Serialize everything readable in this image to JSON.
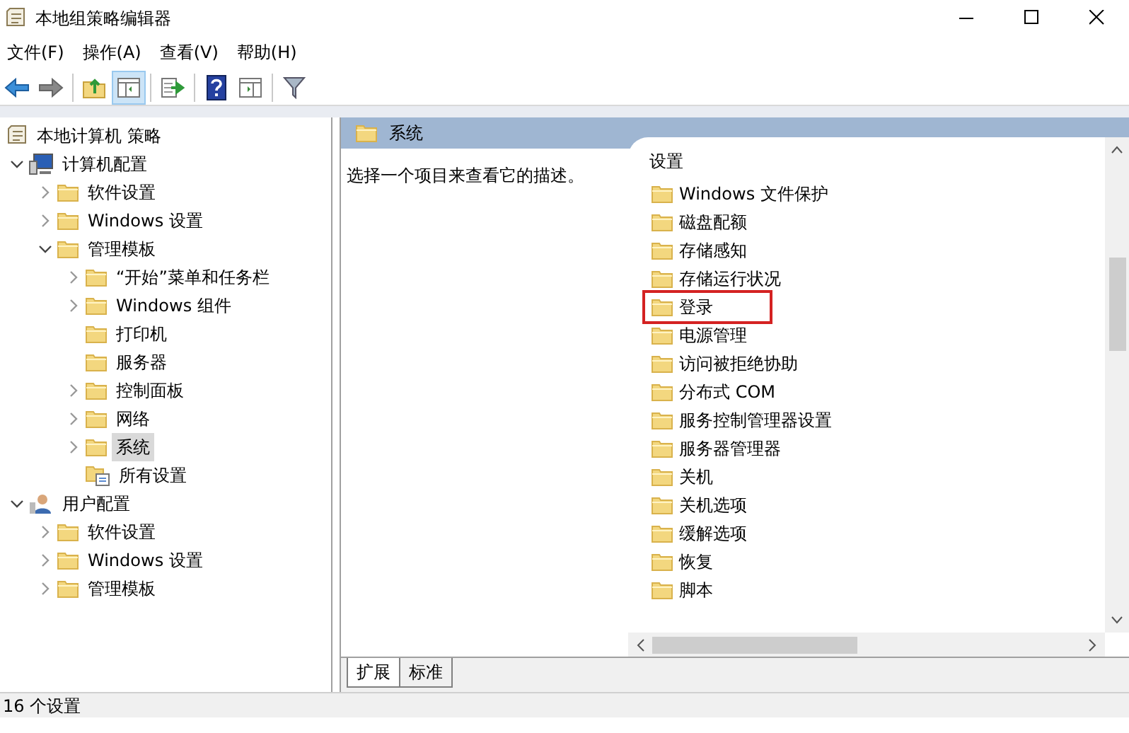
{
  "window": {
    "title": "本地组策略编辑器"
  },
  "menu": [
    "文件(F)",
    "操作(A)",
    "查看(V)",
    "帮助(H)"
  ],
  "toolbar": [
    [
      {
        "kind": "back",
        "pressed": false
      },
      {
        "kind": "forward",
        "pressed": false
      }
    ],
    [
      {
        "kind": "up",
        "pressed": false
      },
      {
        "kind": "tree",
        "pressed": true
      }
    ],
    [
      {
        "kind": "export",
        "pressed": false
      }
    ],
    [
      {
        "kind": "help",
        "pressed": false
      },
      {
        "kind": "pane",
        "pressed": false
      }
    ],
    [
      {
        "kind": "filter",
        "pressed": false
      }
    ]
  ],
  "tree": [
    {
      "label": "本地计算机 策略",
      "kind": "policy",
      "selected": false,
      "children": [
        {
          "label": "计算机配置",
          "kind": "computer",
          "expandable": true,
          "expanded": true,
          "selected": false,
          "children": [
            {
              "label": "软件设置",
              "kind": "folder",
              "expandable": true,
              "expanded": false,
              "selected": false
            },
            {
              "label": "Windows 设置",
              "kind": "folder",
              "expandable": true,
              "expanded": false,
              "selected": false
            },
            {
              "label": "管理模板",
              "kind": "folder",
              "expandable": true,
              "expanded": true,
              "selected": false,
              "children": [
                {
                  "label": "“开始”菜单和任务栏",
                  "kind": "folder",
                  "expandable": true,
                  "expanded": false,
                  "selected": false
                },
                {
                  "label": "Windows 组件",
                  "kind": "folder",
                  "expandable": true,
                  "expanded": false,
                  "selected": false
                },
                {
                  "label": "打印机",
                  "kind": "folder",
                  "expandable": false,
                  "selected": false
                },
                {
                  "label": "服务器",
                  "kind": "folder",
                  "expandable": false,
                  "selected": false
                },
                {
                  "label": "控制面板",
                  "kind": "folder",
                  "expandable": true,
                  "expanded": false,
                  "selected": false
                },
                {
                  "label": "网络",
                  "kind": "folder",
                  "expandable": true,
                  "expanded": false,
                  "selected": false
                },
                {
                  "label": "系统",
                  "kind": "folder",
                  "expandable": true,
                  "expanded": false,
                  "selected": true
                },
                {
                  "label": "所有设置",
                  "kind": "settings",
                  "expandable": false,
                  "selected": false
                }
              ]
            }
          ]
        },
        {
          "label": "用户配置",
          "kind": "user",
          "expandable": true,
          "expanded": true,
          "selected": false,
          "children": [
            {
              "label": "软件设置",
              "kind": "folder",
              "expandable": true,
              "expanded": false,
              "selected": false
            },
            {
              "label": "Windows 设置",
              "kind": "folder",
              "expandable": true,
              "expanded": false,
              "selected": false
            },
            {
              "label": "管理模板",
              "kind": "folder",
              "expandable": true,
              "expanded": false,
              "selected": false
            }
          ]
        }
      ]
    }
  ],
  "details": {
    "header": "系统",
    "description": "选择一个项目来查看它的描述。",
    "column": "设置",
    "items": [
      {
        "label": "Windows 文件保护",
        "highlighted": false
      },
      {
        "label": "磁盘配额",
        "highlighted": false
      },
      {
        "label": "存储感知",
        "highlighted": false
      },
      {
        "label": "存储运行状况",
        "highlighted": false
      },
      {
        "label": "登录",
        "highlighted": true
      },
      {
        "label": "电源管理",
        "highlighted": false
      },
      {
        "label": "访问被拒绝协助",
        "highlighted": false
      },
      {
        "label": "分布式 COM",
        "highlighted": false
      },
      {
        "label": "服务控制管理器设置",
        "highlighted": false
      },
      {
        "label": "服务器管理器",
        "highlighted": false
      },
      {
        "label": "关机",
        "highlighted": false
      },
      {
        "label": "关机选项",
        "highlighted": false
      },
      {
        "label": "缓解选项",
        "highlighted": false
      },
      {
        "label": "恢复",
        "highlighted": false
      },
      {
        "label": "脚本",
        "highlighted": false
      }
    ]
  },
  "tabs": [
    {
      "label": "扩展",
      "selected": true
    },
    {
      "label": "标准",
      "selected": false
    }
  ],
  "status_bar": "16 个设置"
}
